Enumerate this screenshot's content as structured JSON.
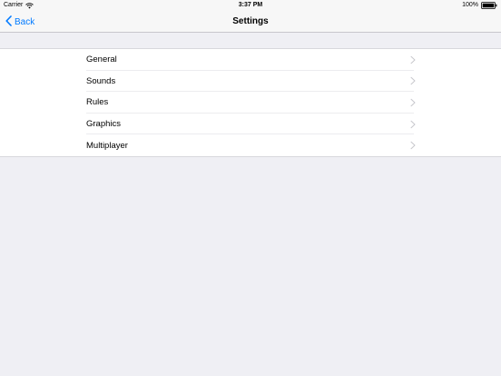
{
  "status_bar": {
    "carrier": "Carrier",
    "time": "3:37 PM",
    "battery": "100%"
  },
  "nav_bar": {
    "back_label": "Back",
    "title": "Settings"
  },
  "settings": {
    "items": [
      {
        "label": "General"
      },
      {
        "label": "Sounds"
      },
      {
        "label": "Rules"
      },
      {
        "label": "Graphics"
      },
      {
        "label": "Multiplayer"
      }
    ]
  },
  "colors": {
    "accent": "#007aff",
    "background": "#efeff4",
    "chevron": "#c7c7cc"
  },
  "icons": {
    "wifi": "wifi-icon",
    "battery": "battery-icon",
    "back": "chevron-left-icon",
    "disclosure": "chevron-right-icon"
  }
}
